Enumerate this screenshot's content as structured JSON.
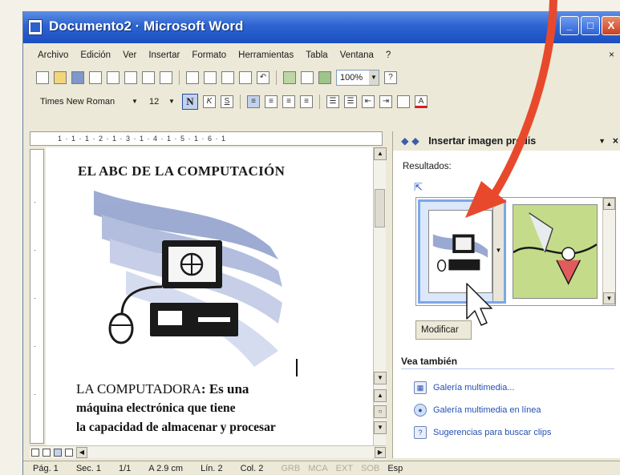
{
  "window": {
    "title": "Documento2 · Microsoft Word",
    "controls": [
      "_",
      "□",
      "X"
    ]
  },
  "menubar": {
    "items": [
      {
        "label": "Archivo",
        "accel": "A"
      },
      {
        "label": "Edición",
        "accel": "E"
      },
      {
        "label": "Ver",
        "accel": "V"
      },
      {
        "label": "Insertar",
        "accel": "I"
      },
      {
        "label": "Formato",
        "accel": "F"
      },
      {
        "label": "Herramientas",
        "accel": "H"
      },
      {
        "label": "Tabla",
        "accel": "T"
      },
      {
        "label": "Ventana",
        "accel": "n"
      },
      {
        "label": "?",
        "accel": "?"
      }
    ],
    "close": "×"
  },
  "toolbar_standard": {
    "zoom": "100%",
    "help": "?"
  },
  "toolbar_format": {
    "font": "Times New Roman",
    "size": "12",
    "bold": "N",
    "underline": "S",
    "font_color": "A"
  },
  "ruler": {
    "horizontal": "1 · 1 · 1 · 2 · 1 · 3 · 1 · 4 · 1 · 5 · 1 · 6 · 1"
  },
  "document": {
    "heading": "EL ABC DE LA COMPUTACIÓN",
    "lead_label": "LA COMPUTADORA",
    "lead_text": ": Es una",
    "line2": "máquina electrónica que tiene",
    "line3": "la capacidad de almacenar y procesar"
  },
  "task_pane": {
    "title": "Insertar imagen predis",
    "results_label": "Resultados:",
    "modify_button": "Modificar",
    "see_also": "Vea también",
    "links": [
      {
        "label": "Galería multimedia...",
        "icon": "gallery-icon"
      },
      {
        "label": "Galería multimedia en línea",
        "icon": "globe-icon"
      },
      {
        "label": "Sugerencias para buscar clips",
        "icon": "help-icon"
      }
    ]
  },
  "statusbar": {
    "page": "Pág. 1",
    "section": "Sec. 1",
    "pages": "1/1",
    "at": "A 2.9 cm",
    "line": "Lín. 2",
    "col": "Col. 2",
    "modes": [
      "GRB",
      "MCA",
      "EXT",
      "SOB"
    ],
    "lang": "Esp"
  },
  "colors": {
    "titlebar": "#2d63d2",
    "arrow": "#e8492c",
    "link": "#2450b4"
  }
}
